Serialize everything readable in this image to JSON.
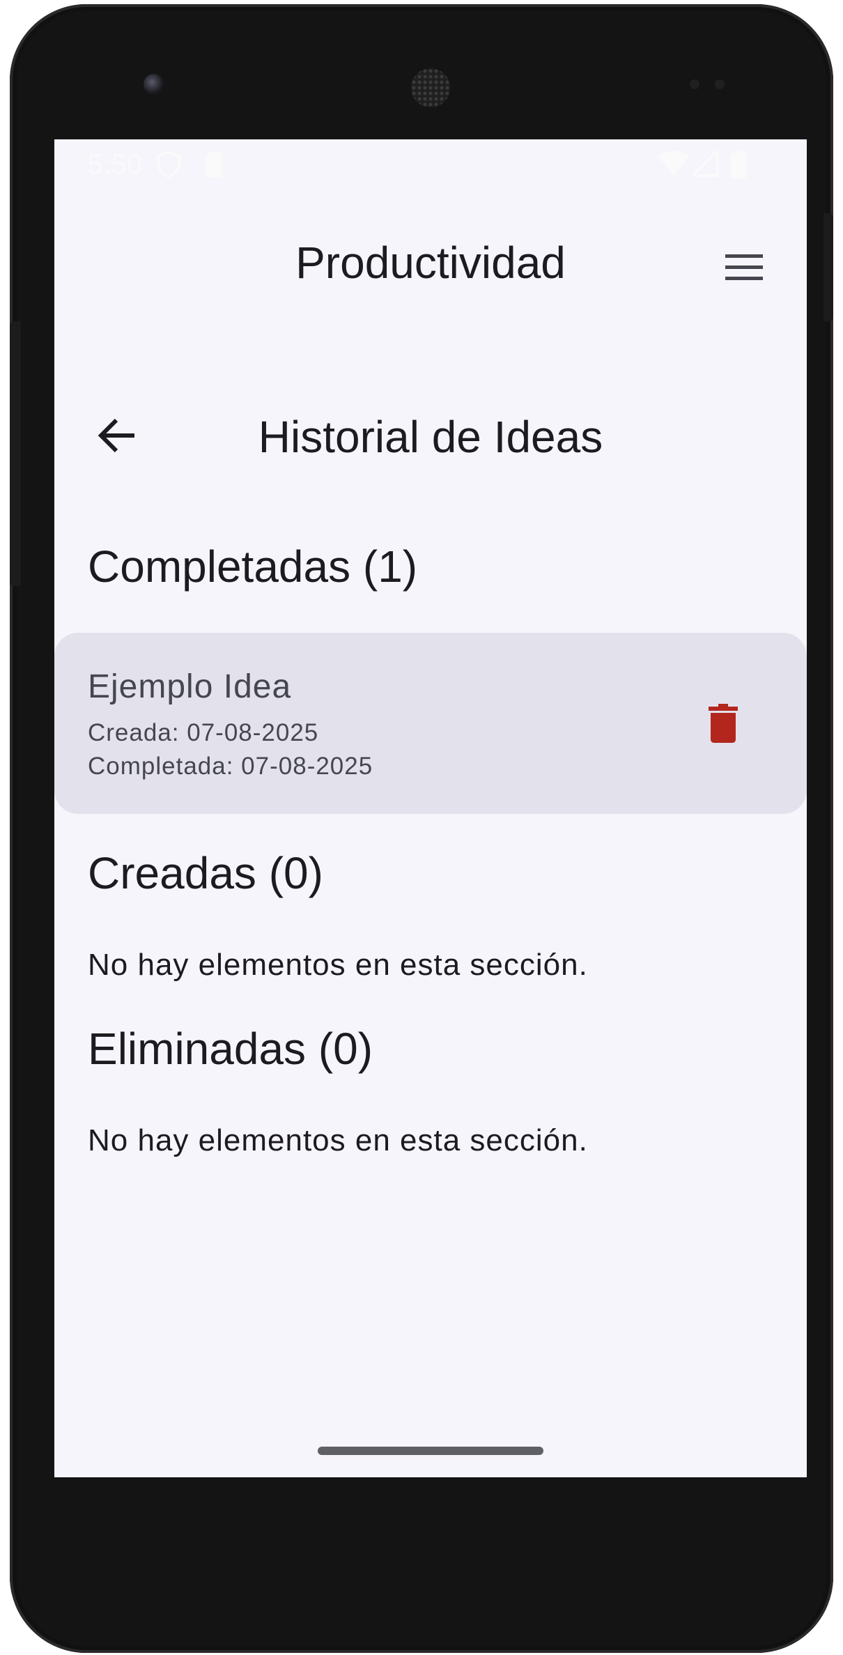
{
  "status_bar": {
    "time": "5:50",
    "icons": [
      "shield-icon",
      "sd-card-icon",
      "wifi-icon",
      "signal-icon",
      "battery-icon"
    ]
  },
  "app_bar": {
    "title": "Productividad",
    "menu_icon": "hamburger-menu-icon"
  },
  "screen": {
    "title": "Historial de Ideas",
    "back_icon": "arrow-back-icon"
  },
  "sections": {
    "completed": {
      "title": "Completadas (1)",
      "items": [
        {
          "title": "Ejemplo Idea",
          "created": "Creada: 07-08-2025",
          "completed": "Completada: 07-08-2025",
          "action_icon": "trash-icon"
        }
      ]
    },
    "created": {
      "title": "Creadas (0)",
      "empty_text": "No hay elementos en esta sección."
    },
    "deleted": {
      "title": "Eliminadas (0)",
      "empty_text": "No hay elementos en esta sección."
    }
  },
  "colors": {
    "background": "#f7f5fc",
    "card": "#e3e2ec",
    "delete": "#b3261e",
    "text": "#1c1b20"
  }
}
